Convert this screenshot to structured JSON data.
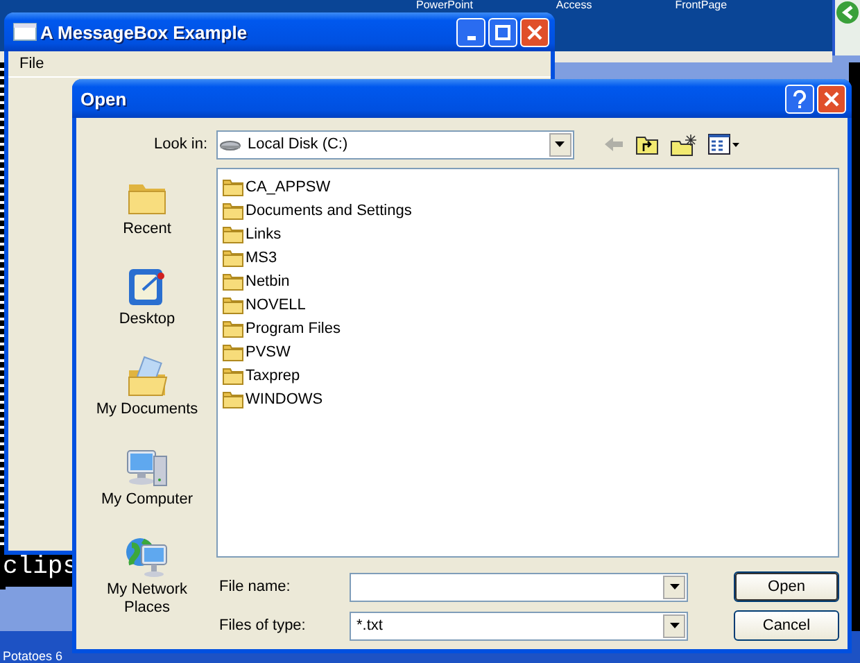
{
  "desktop": {
    "background_labels": [
      "PowerPoint",
      "Access",
      "FrontPage"
    ],
    "console_text": "clips",
    "taskbar_label": "Potatoes 6"
  },
  "main_window": {
    "title": "A MessageBox Example",
    "menu": [
      "File"
    ]
  },
  "dialog": {
    "title": "Open",
    "look_in": {
      "label": "Look in:",
      "value": "Local Disk (C:)"
    },
    "places": [
      {
        "label": "Recent",
        "kind": "recent"
      },
      {
        "label": "Desktop",
        "kind": "desktop"
      },
      {
        "label": "My Documents",
        "kind": "documents"
      },
      {
        "label": "My Computer",
        "kind": "computer"
      },
      {
        "label": "My Network Places",
        "kind": "network"
      }
    ],
    "files": [
      {
        "name": "CA_APPSW"
      },
      {
        "name": "Documents and Settings"
      },
      {
        "name": "Links"
      },
      {
        "name": "MS3"
      },
      {
        "name": "Netbin"
      },
      {
        "name": "NOVELL"
      },
      {
        "name": "Program Files"
      },
      {
        "name": "PVSW"
      },
      {
        "name": "Taxprep"
      },
      {
        "name": "WINDOWS"
      }
    ],
    "file_name": {
      "label": "File name:"
    },
    "file_type": {
      "label": "Files of type:",
      "value": "*.txt"
    },
    "buttons": [
      "Open",
      "Cancel"
    ]
  }
}
